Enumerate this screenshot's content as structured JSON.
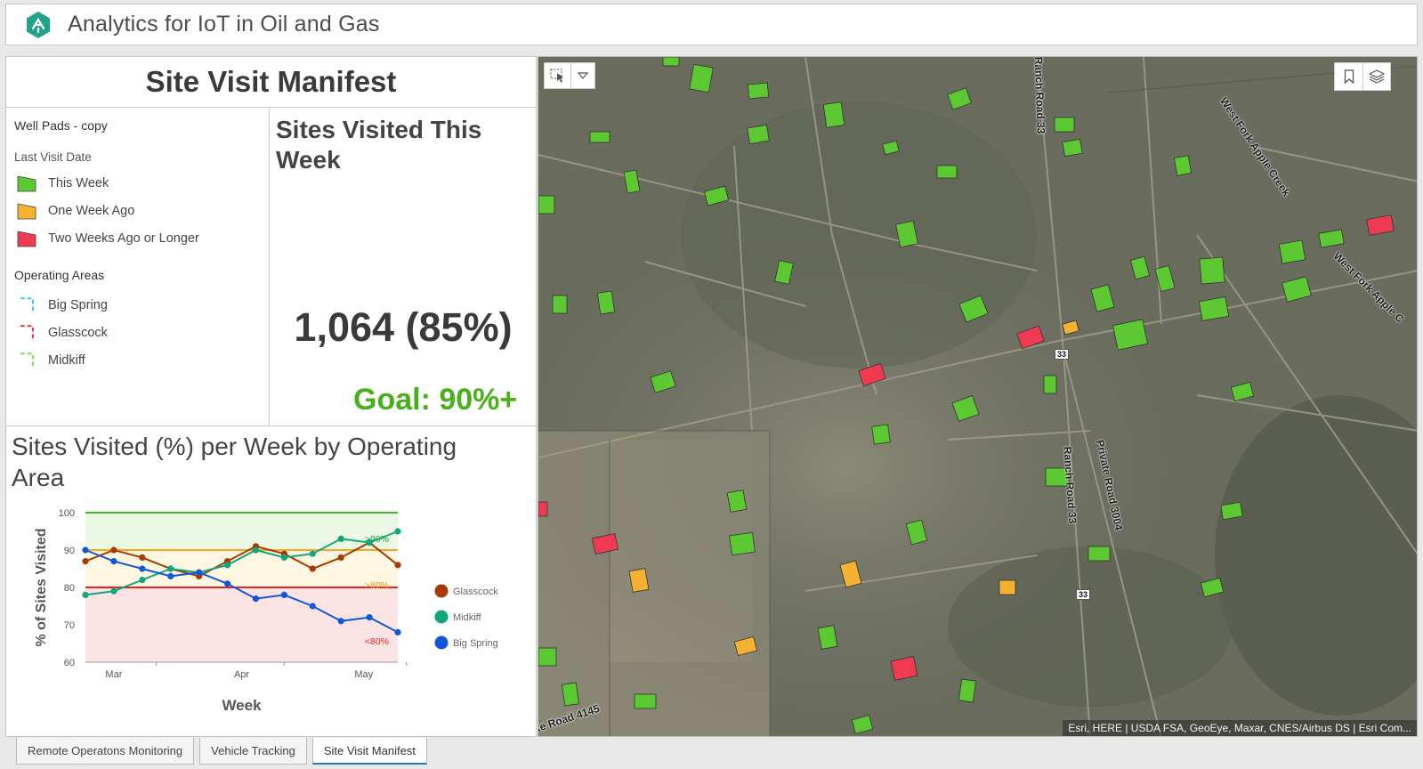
{
  "app": {
    "title": "Analytics for IoT in Oil and Gas"
  },
  "panel": {
    "title": "Site Visit Manifest"
  },
  "legend": {
    "layer_title": "Well Pads - copy",
    "visit_title": "Last Visit Date",
    "items": [
      {
        "label": "This Week",
        "color": "#5cc832"
      },
      {
        "label": "One Week Ago",
        "color": "#f5b231"
      },
      {
        "label": "Two Weeks Ago or Longer",
        "color": "#ef3b51"
      }
    ],
    "areas_title": "Operating Areas",
    "areas": [
      {
        "label": "Big Spring",
        "color": "#3bc3f0"
      },
      {
        "label": "Glasscock",
        "color": "#e8342f"
      },
      {
        "label": "Midkiff",
        "color": "#7ed957"
      }
    ]
  },
  "indicator": {
    "title": "Sites Visited This Week",
    "value": "1,064 (85%)",
    "goal": "Goal: 90%+"
  },
  "chart_section": {
    "title": "Sites Visited (%) per Week by Operating Area"
  },
  "chart_data": {
    "type": "line",
    "xlabel": "Week",
    "ylabel": "% of Sites Visited",
    "ylim": [
      60,
      100
    ],
    "yticks": [
      60,
      70,
      80,
      90,
      100
    ],
    "x": [
      0,
      1,
      2,
      3,
      4,
      5,
      6,
      7,
      8,
      9,
      10,
      11
    ],
    "xtick_labels": [
      {
        "x": 1,
        "label": "Mar"
      },
      {
        "x": 5.5,
        "label": "Apr"
      },
      {
        "x": 9.8,
        "label": "May"
      }
    ],
    "thresholds": [
      {
        "value": 100,
        "color": "#3db828"
      },
      {
        "value": 90,
        "color": "#f5a623",
        "label": ">90%",
        "label_color": "#2c9e2c"
      },
      {
        "value": 80,
        "color": "#e8201e",
        "label": ">80%",
        "label_color": "#e8961e"
      }
    ],
    "band_label_low": {
      "label": "<80%",
      "color": "#e8201e"
    },
    "series": [
      {
        "name": "Glasscock",
        "color": "#a63a00",
        "values": [
          87,
          90,
          88,
          85,
          83,
          87,
          91,
          89,
          85,
          88,
          92,
          86
        ]
      },
      {
        "name": "Midkiff",
        "color": "#12a67c",
        "values": [
          78,
          79,
          82,
          85,
          84,
          86,
          90,
          88,
          89,
          93,
          92,
          95
        ]
      },
      {
        "name": "Big Spring",
        "color": "#1257d9",
        "values": [
          90,
          87,
          85,
          83,
          84,
          81,
          77,
          78,
          75,
          71,
          72,
          68
        ]
      }
    ]
  },
  "map": {
    "attribution": "Esri, HERE | USDA FSA, GeoEye, Maxar, CNES/Airbus DS | Esri Com...",
    "road_labels": [
      "Ranch Road 33",
      "Ranch Road 33",
      "Private Road 3004",
      "West Fork Apple Creek",
      "West Fork Apple C",
      "te Road 4145"
    ],
    "shields": [
      "33",
      "33"
    ]
  },
  "tabs": [
    {
      "label": "Remote Operatons Monitoring",
      "active": false
    },
    {
      "label": "Vehicle Tracking",
      "active": false
    },
    {
      "label": "Site Visit Manifest",
      "active": true
    }
  ]
}
